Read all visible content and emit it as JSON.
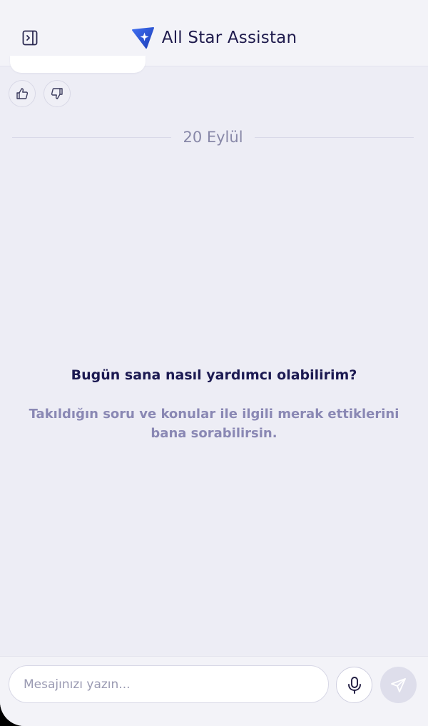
{
  "header": {
    "title": "All Star Assistan",
    "toggle_icon": "sidebar-toggle-icon",
    "logo_icon": "star-badge-icon"
  },
  "feedback": {
    "like_icon": "thumbs-up-icon",
    "dislike_icon": "thumbs-down-icon"
  },
  "chat": {
    "date_separator": "20 Eylül"
  },
  "welcome": {
    "title": "Bugün sana nasıl yardımcı olabilirim?",
    "subtitle": "Takıldığın soru ve konular ile ilgili merak ettiklerini bana sorabilirsin."
  },
  "composer": {
    "placeholder": "Mesajınızı yazın...",
    "value": "",
    "mic_icon": "microphone-icon",
    "send_icon": "send-icon"
  },
  "colors": {
    "background": "#ededf5",
    "title": "#1c1a52",
    "muted": "#8a88b4",
    "brand_blue": "#2f55d4"
  }
}
